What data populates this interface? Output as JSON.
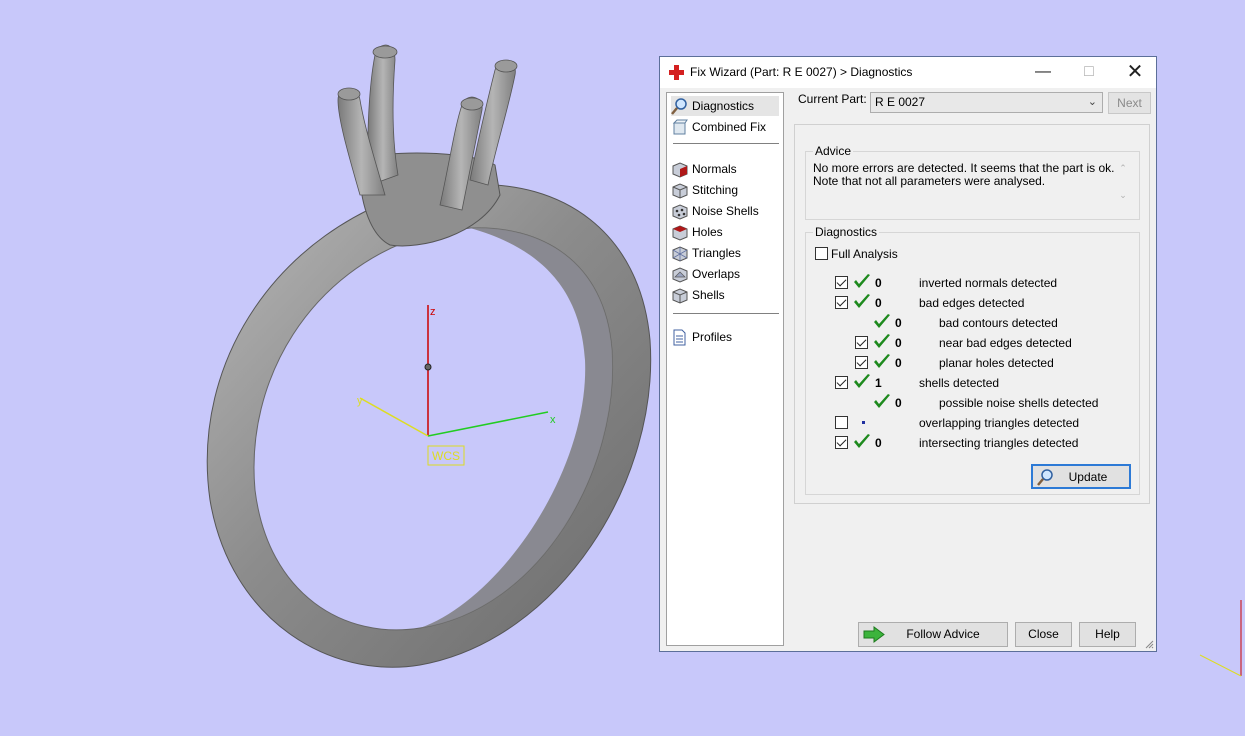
{
  "wcs": {
    "z": "z",
    "y": "y",
    "x": "x",
    "label": "WCS"
  },
  "dialog": {
    "title": "Fix Wizard (Part: R E 0027) > Diagnostics",
    "nav": [
      {
        "label": "Diagnostics",
        "icon": "magnifier-icon",
        "selected": true
      },
      {
        "label": "Combined Fix",
        "icon": "combined-fix-icon"
      },
      {
        "label": "Normals",
        "icon": "normals-cube-icon"
      },
      {
        "label": "Stitching",
        "icon": "stitching-cube-icon"
      },
      {
        "label": "Noise Shells",
        "icon": "noise-shells-cube-icon"
      },
      {
        "label": "Holes",
        "icon": "holes-cube-icon"
      },
      {
        "label": "Triangles",
        "icon": "triangles-cube-icon"
      },
      {
        "label": "Overlaps",
        "icon": "overlaps-cube-icon"
      },
      {
        "label": "Shells",
        "icon": "shells-cube-icon"
      },
      {
        "label": "Profiles",
        "icon": "document-icon"
      }
    ],
    "current_part_label": "Current Part:",
    "current_part_value": "R E 0027",
    "next_label": "Next",
    "advice": {
      "title": "Advice",
      "line1": "No more errors are detected. It seems that the part is ok.",
      "line2": "Note that not all parameters were analysed."
    },
    "diagnostics": {
      "title": "Diagnostics",
      "full_analysis_label": "Full Analysis",
      "full_analysis_checked": false,
      "rows": [
        {
          "checkbox": true,
          "checked": true,
          "status": "ok",
          "count": "0",
          "label": "inverted normals detected",
          "indent": 0
        },
        {
          "checkbox": true,
          "checked": true,
          "status": "ok",
          "count": "0",
          "label": "bad edges detected",
          "indent": 0
        },
        {
          "checkbox": false,
          "checked": false,
          "status": "ok",
          "count": "0",
          "label": "bad contours detected",
          "indent": 1
        },
        {
          "checkbox": true,
          "checked": true,
          "status": "ok",
          "count": "0",
          "label": "near bad edges detected",
          "indent": 1
        },
        {
          "checkbox": true,
          "checked": true,
          "status": "ok",
          "count": "0",
          "label": "planar holes detected",
          "indent": 1
        },
        {
          "checkbox": true,
          "checked": true,
          "status": "ok",
          "count": "1",
          "label": "shells detected",
          "indent": 0
        },
        {
          "checkbox": false,
          "checked": false,
          "status": "ok",
          "count": "0",
          "label": "possible noise shells detected",
          "indent": 1
        },
        {
          "checkbox": true,
          "checked": false,
          "status": "pending",
          "count": "",
          "label": "overlapping triangles detected",
          "indent": 0
        },
        {
          "checkbox": true,
          "checked": true,
          "status": "ok",
          "count": "0",
          "label": "intersecting triangles detected",
          "indent": 0
        }
      ],
      "update_label": "Update"
    },
    "follow_advice_label": "Follow Advice",
    "close_label": "Close",
    "help_label": "Help"
  },
  "colors": {
    "background": "#c8c8fa",
    "ring": "#8a8a8a",
    "axis_z": "#cc0000",
    "axis_x": "#22cc22",
    "axis_y": "#dddd22",
    "check_green": "#1e8a1e"
  }
}
